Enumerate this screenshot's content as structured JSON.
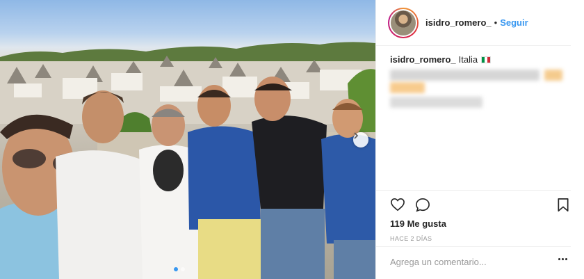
{
  "post": {
    "username": "isidro_romero_",
    "separator": "•",
    "follow_label": "Seguir",
    "location": "Italia",
    "likes": "119 Me gusta",
    "time_ago": "HACE 2 DÍAS",
    "comment_placeholder": "Agrega un comentario...",
    "carousel": {
      "slide_count": 2,
      "active_slide": 1
    }
  },
  "icons": {
    "like": "heart-icon",
    "comment": "comment-bubble-icon",
    "save": "bookmark-icon",
    "more": "more-options-icon",
    "next": "chevron-right-icon",
    "flag": "italy-flag-icon"
  },
  "colors": {
    "link": "#3897f0",
    "text": "#262626",
    "muted": "#999999",
    "border": "#efefef",
    "flag_green": "#009246",
    "flag_white": "#ffffff",
    "flag_red": "#ce2b37"
  }
}
